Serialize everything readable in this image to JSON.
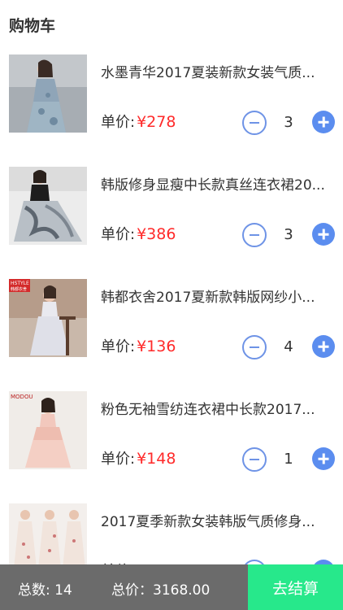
{
  "header": {
    "title": "购物车"
  },
  "price_label": "单价:",
  "items": [
    {
      "title": "水墨青华2017夏装新款女装气质...",
      "price": "¥278",
      "quantity": "3"
    },
    {
      "title": "韩版修身显瘦中长款真丝连衣裙20...",
      "price": "¥386",
      "quantity": "3"
    },
    {
      "title": "韩都衣舍2017夏新款韩版网纱小...",
      "price": "¥136",
      "quantity": "4"
    },
    {
      "title": "粉色无袖雪纺连衣裙中长款2017...",
      "price": "¥148",
      "quantity": "1"
    },
    {
      "title": "2017夏季新款女装韩版气质修身...",
      "price": "",
      "quantity": ""
    }
  ],
  "thumb_text": {
    "hstyle": "HSTYLE",
    "hstyle_sub": "韩都衣舍",
    "modou": "MODOU"
  },
  "footer": {
    "total_count": "总数: 14",
    "total_price": "总价：3168.00",
    "checkout_label": "去结算"
  },
  "colors": {
    "accent": "#5b8def",
    "price": "#ff2a2a",
    "checkout": "#27e88b",
    "footer_bg": "#6b6b6b"
  }
}
